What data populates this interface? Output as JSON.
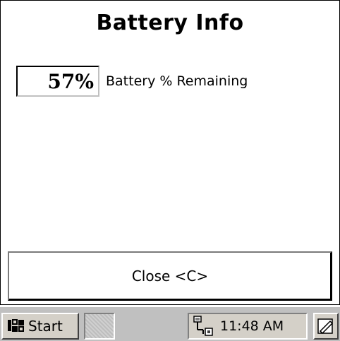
{
  "window": {
    "title": "Battery Info"
  },
  "battery": {
    "percent_text": "57%",
    "percent_value": 57,
    "label": "Battery % Remaining"
  },
  "close_button": {
    "label": "Close <C>"
  },
  "taskbar": {
    "start_label": "Start",
    "start_icon": "windows-flag-icon",
    "network_icon": "network-connection-icon",
    "clock": "11:48 AM",
    "input_icon": "stylus-pen-icon"
  }
}
